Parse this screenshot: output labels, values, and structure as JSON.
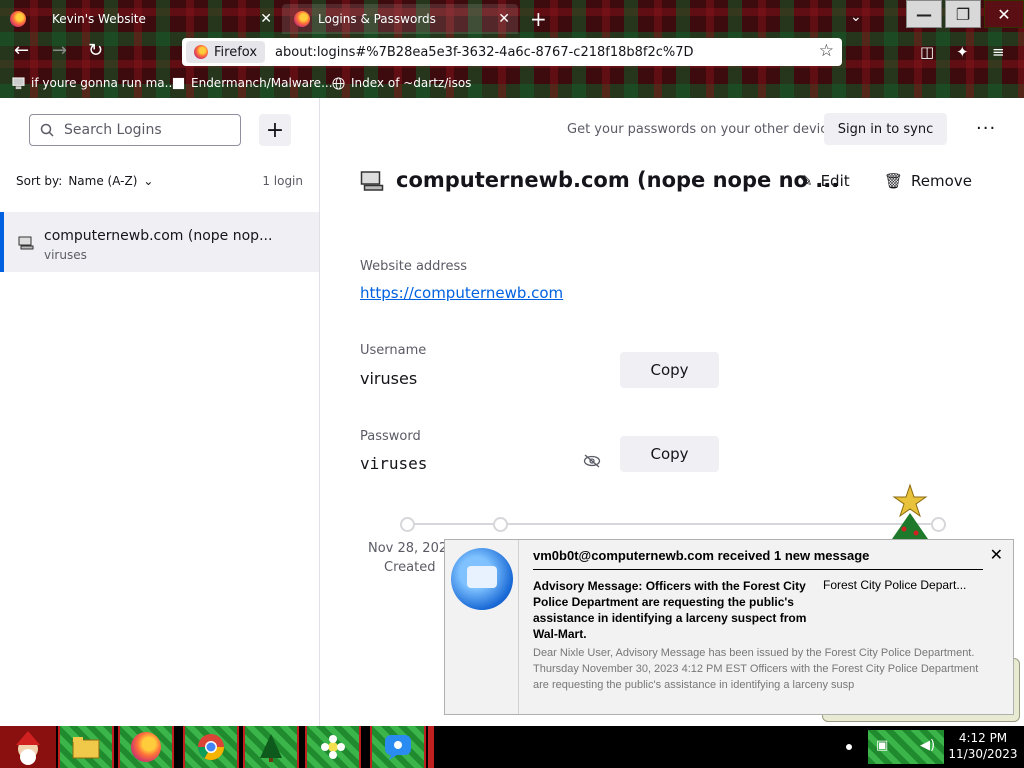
{
  "browser": {
    "tabs": [
      {
        "label": "Kevin's Website",
        "active": false
      },
      {
        "label": "Logins & Passwords",
        "active": true
      }
    ],
    "url_identity": "Firefox",
    "url": "about:logins#%7B28ea5e3f-3632-4a6c-8767-c218f18b8f2c%7D",
    "bookmarks": [
      {
        "label": "if youre gonna run ma...",
        "icon": "computer-icon"
      },
      {
        "label": "Endermanch/Malware...",
        "icon": "page-icon"
      },
      {
        "label": "Index of ~dartz/isos",
        "icon": "globe-icon"
      }
    ]
  },
  "sidebar": {
    "search_placeholder": "Search Logins",
    "add_label": "+",
    "sort_label": "Sort by:",
    "sort_value": "Name (A-Z)",
    "count": "1 login",
    "items": [
      {
        "title": "computernewb.com (nope nop...",
        "username": "viruses"
      }
    ]
  },
  "main": {
    "sync_text": "Get your passwords on your other devices",
    "sync_button": "Sign in to sync",
    "more": "···",
    "title": "computernewb.com (nope nope no ...",
    "edit_label": "Edit",
    "remove_label": "Remove",
    "website_label": "Website address",
    "website_value": "https://computernewb.com",
    "username_label": "Username",
    "username_value": "viruses",
    "password_label": "Password",
    "password_value": "viruses",
    "copy_label": "Copy",
    "created_date": "Nov 28, 2023",
    "created_label": "Created"
  },
  "notification": {
    "header": "vm0b0t@computernewb.com received 1 new message",
    "close": "✕",
    "subject": "Advisory Message: Officers with the Forest City Police Department are requesting the public's assistance in identifying a larceny suspect from Wal-Mart.",
    "from": "Forest City Police Depart...",
    "body": "Dear Nixle User, Advisory Message has been issued by the Forest City Police Department. Thursday November 30, 2023 4:12 PM EST Officers with the Forest City Police Department are requesting the public's assistance in identifying a larceny susp"
  },
  "taskbar": {
    "time": "4:12 PM",
    "date": "11/30/2023"
  },
  "colors": {
    "accent": "#0061e0",
    "link": "#0061e0",
    "muted": "#5b5b66"
  }
}
